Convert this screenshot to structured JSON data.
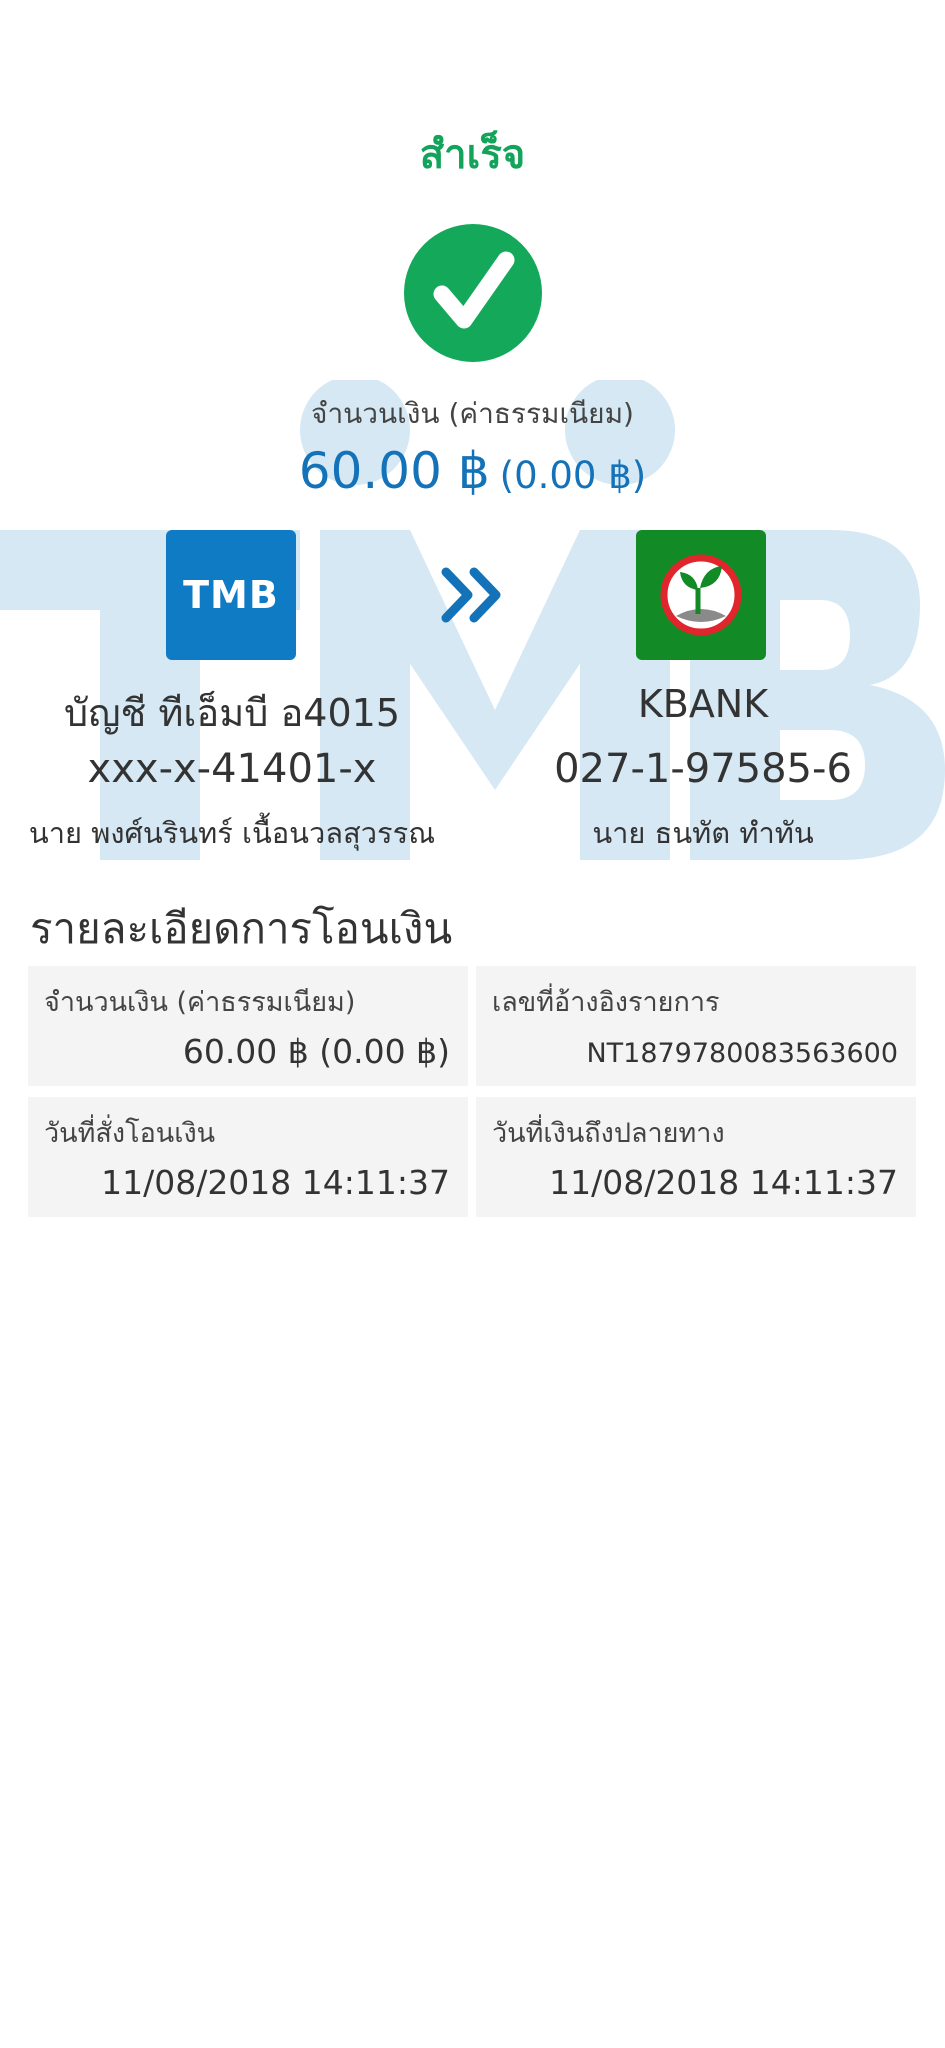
{
  "status": {
    "title": "สำเร็จ",
    "icon": "check-circle-icon",
    "color": "#13a35a"
  },
  "amount": {
    "label": "จำนวนเงิน (ค่าธรรมเนียม)",
    "value": "60.00 ฿",
    "fee": "(0.00 ฿)",
    "color": "#1372b8"
  },
  "watermark": {
    "text": "TMB",
    "color": "#d5e8f4"
  },
  "from_account": {
    "bank_logo": "TMB",
    "bank_logo_icon": "tmb-logo-icon",
    "name": "บัญชี ทีเอ็มบี อ4015",
    "number": "xxx-x-41401-x",
    "owner": "นาย พงศ์นรินทร์ เนื้อนวลสุวรรณ",
    "color": "#0f7bc4"
  },
  "transfer_arrow_icon": "double-chevron-right-icon",
  "to_account": {
    "bank_logo_icon": "kbank-logo-icon",
    "name": "KBANK",
    "number": "027-1-97585-6",
    "owner": "นาย ธนทัต ทำทัน",
    "color": "#128a25"
  },
  "details": {
    "heading": "รายละเอียดการโอนเงิน",
    "items": [
      {
        "label": "จำนวนเงิน (ค่าธรรมเนียม)",
        "value": "60.00 ฿ (0.00 ฿)"
      },
      {
        "label": "เลขที่อ้างอิงรายการ",
        "value": "NT1879780083563600"
      },
      {
        "label": "วันที่สั่งโอนเงิน",
        "value": "11/08/2018 14:11:37"
      },
      {
        "label": "วันที่เงินถึงปลายทาง",
        "value": "11/08/2018 14:11:37"
      }
    ]
  }
}
